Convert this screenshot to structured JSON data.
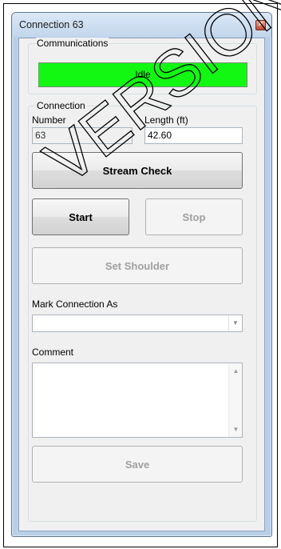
{
  "window": {
    "title": "Connection 63",
    "close_glyph": "×"
  },
  "communications": {
    "group_label": "Communications",
    "status_text": "Idle",
    "status_color": "#12f812"
  },
  "connection": {
    "group_label": "Connection",
    "number_label": "Number",
    "number_value": "63",
    "length_label": "Length (ft)",
    "length_value": "42.60"
  },
  "buttons": {
    "stream_check": "Stream Check",
    "start": "Start",
    "stop": "Stop",
    "set_shoulder": "Set Shoulder",
    "save": "Save"
  },
  "mark": {
    "label": "Mark Connection As",
    "selected": ""
  },
  "comment": {
    "label": "Comment",
    "value": ""
  },
  "watermark": {
    "text": "VERSION"
  }
}
